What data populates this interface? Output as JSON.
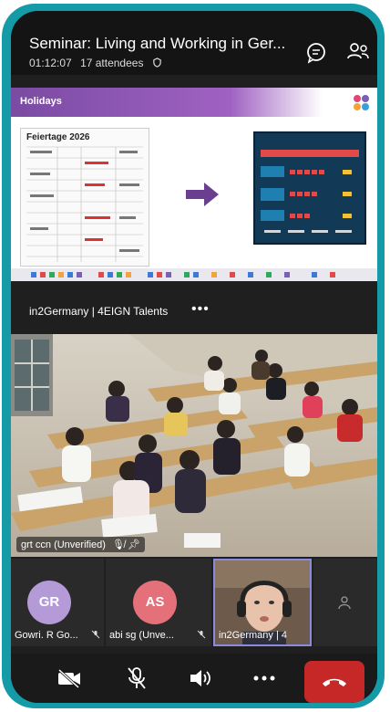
{
  "header": {
    "title": "Seminar: Living and Working in Ger...",
    "elapsed": "01:12:07",
    "attendees": "17 attendees"
  },
  "slide": {
    "section_title": "Holidays",
    "doc_title": "Feiertage 2026"
  },
  "presenter": {
    "name": "in2Germany | 4EIGN Talents"
  },
  "main_video": {
    "label": "grt ccn (Unverified)"
  },
  "participants": [
    {
      "initials": "GR",
      "name": "Gowri. R Go...",
      "color": "#b49ad6"
    },
    {
      "initials": "AS",
      "name": "abi sg (Unve...",
      "color": "#e4707a"
    },
    {
      "initials": "",
      "name": "in2Germany | 4",
      "color": "#6e5a4a"
    }
  ],
  "colors": {
    "accent": "#159aa8",
    "end_call": "#c62828",
    "active_speaker_border": "#8a8ae0"
  },
  "icons": {
    "chat": "chat-icon",
    "people": "people-icon",
    "camera_off": "camera-off-icon",
    "mic_off": "mic-off-icon",
    "speaker": "speaker-icon",
    "more": "more-icon",
    "hang_up": "phone-hangup-icon"
  }
}
